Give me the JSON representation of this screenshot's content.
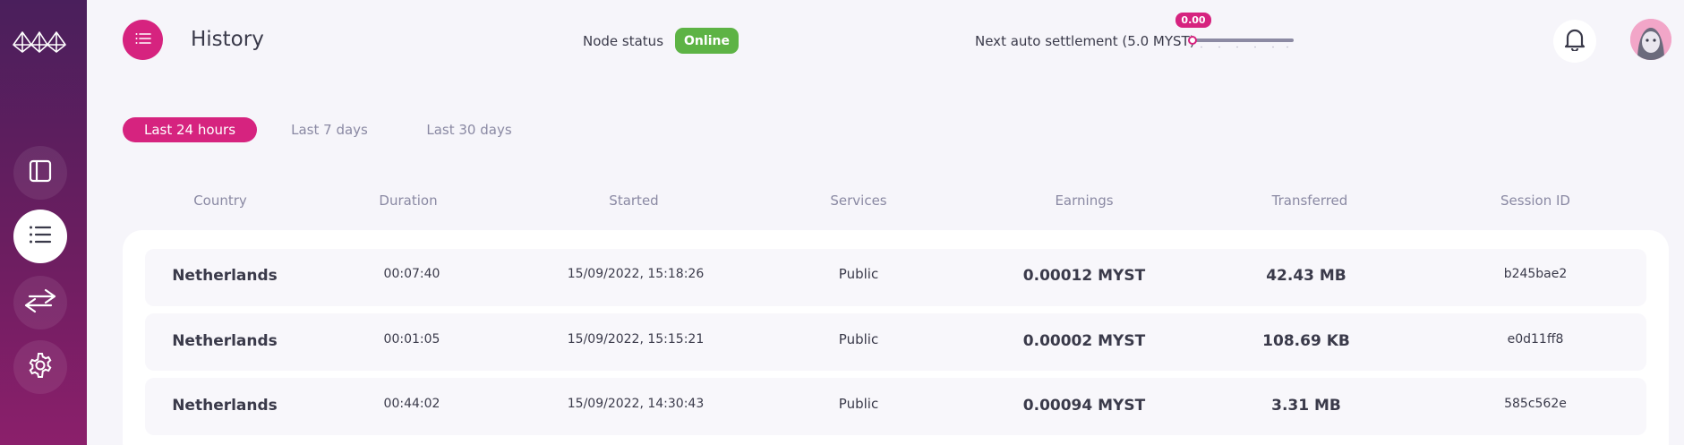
{
  "header": {
    "title": "History",
    "node_status_label": "Node status",
    "node_status_value": "Online",
    "settlement_label": "Next auto settlement (5.0 MYST)",
    "settlement_value": "0.00",
    "settlement_progress": 0.0
  },
  "sidebar": {
    "items": [
      {
        "name": "dashboard",
        "icon": "sidebar-layout-icon"
      },
      {
        "name": "history",
        "icon": "list-icon",
        "active": true
      },
      {
        "name": "transactions",
        "icon": "transfer-arrows-icon"
      },
      {
        "name": "settings",
        "icon": "gear-icon"
      }
    ]
  },
  "tabs": [
    "Last 24 hours",
    "Last 7 days",
    "Last 30 days"
  ],
  "table": {
    "columns": [
      "Country",
      "Duration",
      "Started",
      "Services",
      "Earnings",
      "Transferred",
      "Session ID"
    ],
    "rows": [
      {
        "country": "Netherlands",
        "duration": "00:07:40",
        "started": "15/09/2022, 15:18:26",
        "services": "Public",
        "earnings": "0.00012 MYST",
        "transferred": "42.43 MB",
        "session_id": "b245bae2"
      },
      {
        "country": "Netherlands",
        "duration": "00:01:05",
        "started": "15/09/2022, 15:15:21",
        "services": "Public",
        "earnings": "0.00002 MYST",
        "transferred": "108.69 KB",
        "session_id": "e0d11ff8"
      },
      {
        "country": "Netherlands",
        "duration": "00:44:02",
        "started": "15/09/2022, 14:30:43",
        "services": "Public",
        "earnings": "0.00094 MYST",
        "transferred": "3.31 MB",
        "session_id": "585c562e"
      }
    ]
  },
  "colors": {
    "accent": "#d6237f",
    "online": "#5db345",
    "sidebar_top": "#4a1f5c",
    "sidebar_bottom": "#8b1f6b"
  }
}
